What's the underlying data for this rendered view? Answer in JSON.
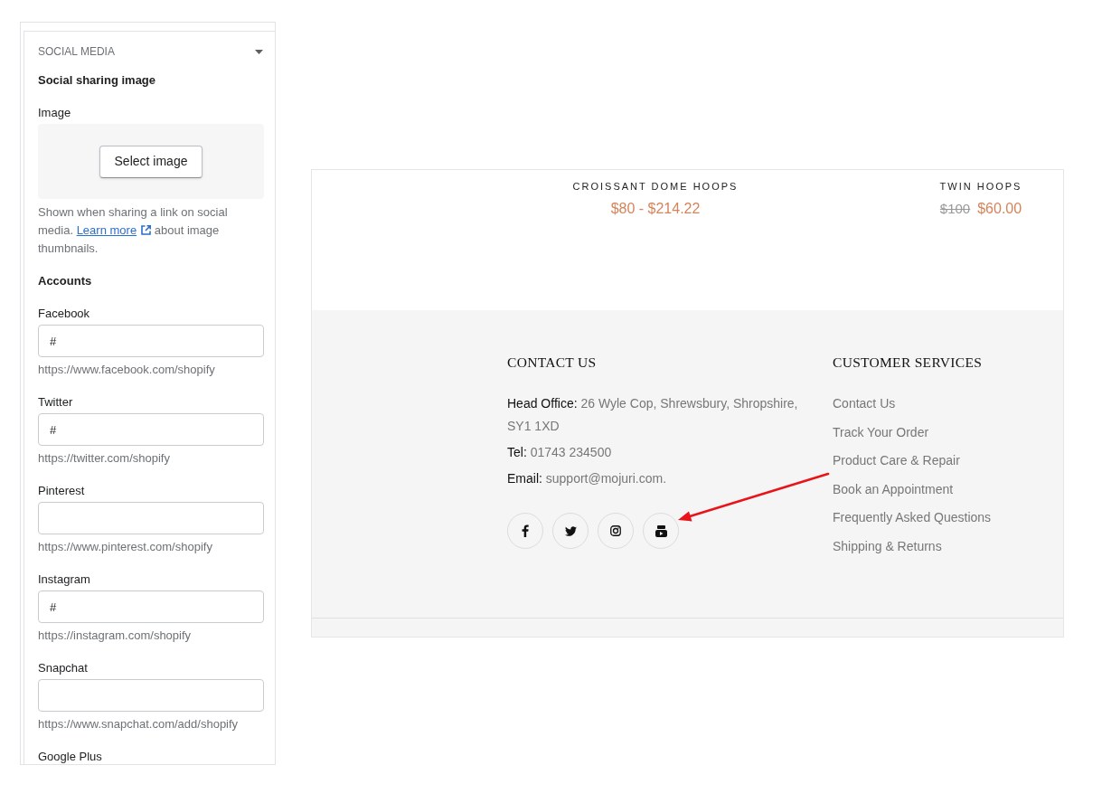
{
  "settings_panel": {
    "section": {
      "title": "SOCIAL MEDIA",
      "expanded": true
    },
    "sharing_image": {
      "heading": "Social sharing image",
      "label": "Image",
      "button": "Select image",
      "help": {
        "text_before": "Shown when sharing a link on social media.",
        "link": "Learn more",
        "text_after": "about image thumbnails."
      }
    },
    "accounts": {
      "heading": "Accounts",
      "fields": [
        {
          "label": "Facebook",
          "value": "#",
          "hint": "https://www.facebook.com/shopify"
        },
        {
          "label": "Twitter",
          "value": "#",
          "hint": "https://twitter.com/shopify"
        },
        {
          "label": "Pinterest",
          "hint": "https://www.pinterest.com/shopify"
        },
        {
          "label": "Instagram",
          "value": "#",
          "hint": "https://instagram.com/shopify"
        },
        {
          "label": "Snapchat",
          "hint": "https://www.snapchat.com/add/shopify"
        },
        {
          "label": "Google Plus"
        }
      ]
    }
  },
  "preview": {
    "products": [
      {
        "name": "CROISSANT DOME HOOPS",
        "price": "$80 - $214.22"
      },
      {
        "name": "TWIN HOOPS",
        "compare_at_price": "$100",
        "price": "$60.00"
      }
    ],
    "footer": {
      "contact": {
        "heading": "CONTACT US",
        "lines": [
          {
            "label": "Head Office:",
            "value": "26 Wyle Cop, Shrewsbury, Shropshire, SY1 1XD"
          },
          {
            "label": "Tel:",
            "value": "01743 234500"
          },
          {
            "label": "Email:",
            "value": "support@mojuri.com."
          }
        ],
        "social_links": [
          {
            "kind": "facebook"
          },
          {
            "kind": "twitter"
          },
          {
            "kind": "instagram"
          },
          {
            "kind": "youtube"
          }
        ]
      },
      "customer_services": {
        "heading": "CUSTOMER SERVICES",
        "links": [
          "Contact Us",
          "Track Your Order",
          "Product Care & Repair",
          "Book an Appointment",
          "Frequently Asked Questions",
          "Shipping & Returns"
        ]
      }
    }
  }
}
